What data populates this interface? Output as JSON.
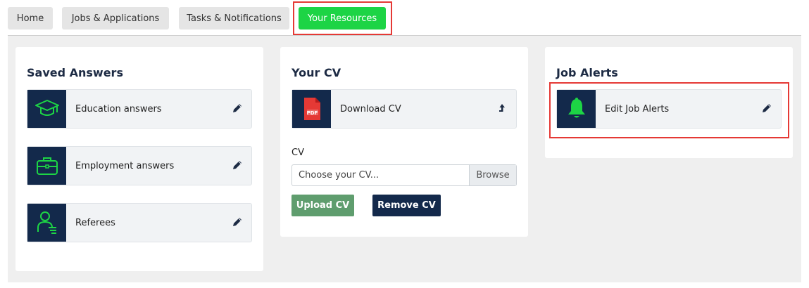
{
  "tabs": [
    {
      "label": "Home"
    },
    {
      "label": "Jobs & Applications"
    },
    {
      "label": "Tasks & Notifications"
    },
    {
      "label": "Your Resources",
      "active": true
    }
  ],
  "colors": {
    "active_tab": "#1dd445",
    "navy": "#13294b",
    "icon_green": "#1dd445",
    "highlight": "#e53935",
    "upload_button": "#5f9d6e"
  },
  "saved_answers": {
    "title": "Saved Answers",
    "items": [
      {
        "label": "Education answers",
        "icon": "graduation-cap-icon"
      },
      {
        "label": "Employment answers",
        "icon": "briefcase-icon"
      },
      {
        "label": "Referees",
        "icon": "referee-user-icon"
      }
    ]
  },
  "your_cv": {
    "title": "Your CV",
    "download": {
      "label": "Download CV",
      "icon": "pdf-file-icon"
    },
    "cv_label": "CV",
    "file_placeholder": "Choose your CV...",
    "browse_label": "Browse",
    "upload_label": "Upload CV",
    "remove_label": "Remove CV"
  },
  "job_alerts": {
    "title": "Job Alerts",
    "edit": {
      "label": "Edit Job Alerts",
      "icon": "bell-icon"
    }
  }
}
